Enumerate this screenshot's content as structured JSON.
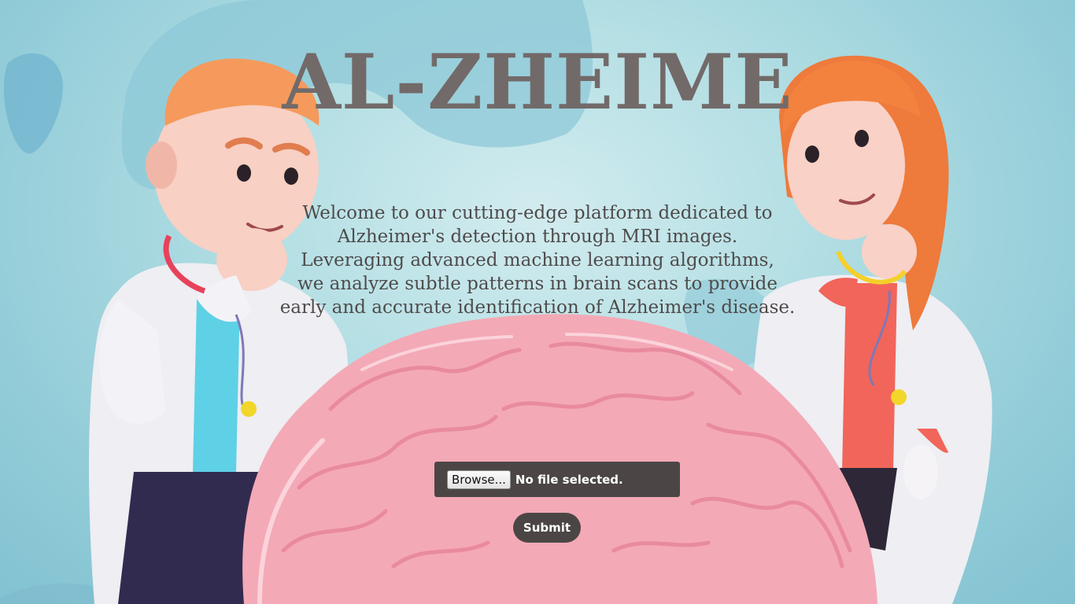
{
  "page": {
    "title": "AL-ZHEIME",
    "intro_lines": [
      "Welcome to our cutting-edge platform dedicated to",
      "Alzheimer's detection through MRI images.",
      "Leveraging advanced machine learning algorithms,",
      "we analyze subtle patterns in brain scans to provide",
      "early and accurate identification of Alzheimer's disease."
    ]
  },
  "upload": {
    "browse_label": "Browse...",
    "file_status": "No file selected."
  },
  "form": {
    "submit_label": "Submit"
  },
  "colors": {
    "background": "#b4dfe4",
    "title": "#726a69",
    "panel": "#4b4645",
    "brain": "#f4a9b6"
  }
}
